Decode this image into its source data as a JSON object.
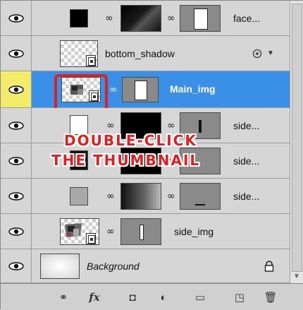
{
  "window": {
    "title": ""
  },
  "layers": [
    {
      "name": "face...",
      "visible": true,
      "selected": false
    },
    {
      "name": "bottom_shadow",
      "visible": true,
      "selected": false
    },
    {
      "name": "Main_img",
      "visible": true,
      "selected": true
    },
    {
      "name": "side...",
      "visible": true,
      "selected": false
    },
    {
      "name": "side...",
      "visible": true,
      "selected": false
    },
    {
      "name": "side...",
      "visible": true,
      "selected": false
    },
    {
      "name": "side_img",
      "visible": true,
      "selected": false
    },
    {
      "name": "Background",
      "visible": true,
      "selected": false
    }
  ],
  "annotation": {
    "line1": "DOUBLE-CLICK",
    "line2": "THE THUMBNAIL",
    "color": "#e02020"
  },
  "colors": {
    "panel_bg": "#d6d6d6",
    "selected_row": "#3a8fe6",
    "eye_selected_bg": "#f3ec6a"
  },
  "icons": {
    "visibility": "eye-icon",
    "link": "chain-link-icon",
    "smart_object": "smart-object-badge-icon",
    "effects": "fx-icon",
    "lock": "lock-icon"
  },
  "bottom_toolbar": [
    {
      "name": "link-layers",
      "glyph": "⚭"
    },
    {
      "name": "layer-style",
      "glyph": "fx"
    },
    {
      "name": "add-mask",
      "glyph": "◘"
    },
    {
      "name": "adjustment",
      "glyph": "◐"
    },
    {
      "name": "new-group",
      "glyph": "▭"
    },
    {
      "name": "new-layer",
      "glyph": "◳"
    },
    {
      "name": "delete-layer",
      "glyph": "🗑"
    }
  ]
}
